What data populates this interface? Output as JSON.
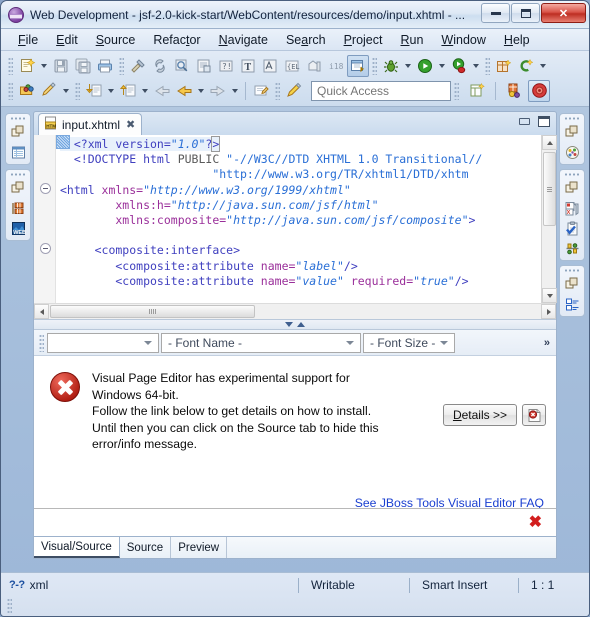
{
  "window": {
    "title": "Web Development - jsf-2.0-kick-start/WebContent/resources/demo/input.xhtml - ...",
    "logo_name": "eclipse-logo",
    "buttons": {
      "minimize": "minimize",
      "maximize": "maximize",
      "close": "close"
    }
  },
  "menubar": {
    "items": [
      {
        "label": "File",
        "mnemonic": "F"
      },
      {
        "label": "Edit",
        "mnemonic": "E"
      },
      {
        "label": "Source",
        "mnemonic": "S"
      },
      {
        "label": "Refactor",
        "mnemonic": "t"
      },
      {
        "label": "Navigate",
        "mnemonic": "N"
      },
      {
        "label": "Search",
        "mnemonic": "a"
      },
      {
        "label": "Project",
        "mnemonic": "P"
      },
      {
        "label": "Run",
        "mnemonic": "R"
      },
      {
        "label": "Window",
        "mnemonic": "W"
      },
      {
        "label": "Help",
        "mnemonic": "H"
      }
    ]
  },
  "toolbar": {
    "row1": [
      "new-wizard-icon",
      "new-wizard-dropdown",
      "save-icon",
      "save-all-icon",
      "print-icon",
      "build-all-icon",
      "link-icon",
      "search-icon",
      "print-preview-icon",
      "external-tools-icon",
      "text-tool-icon",
      "spellcheck-icon",
      "el-validator-icon",
      "open-type-icon",
      "i18n-icon",
      "open-web-browser-icon",
      "debug-icon",
      "debug-dropdown",
      "run-icon",
      "run-dropdown",
      "run-as-server-icon",
      "run-as-dropdown",
      "new-jsf-project-icon",
      "new-seam-icon",
      "new-seam-dropdown"
    ],
    "row2": [
      "open-resource-icon",
      "annotation-icon",
      "annotation-dropdown",
      "next-annotation-icon",
      "next-annotation-dropdown",
      "previous-annotation-icon",
      "previous-annotation-dropdown",
      "back-icon",
      "back-arrow-icon",
      "back-dropdown",
      "forward-arrow-icon",
      "forward-dropdown",
      "open-task-icon",
      "pencil-icon"
    ],
    "quick_access": {
      "placeholder": "Quick Access",
      "value": ""
    },
    "perspective": {
      "open_perspective": "open-perspective-icon",
      "web_development": "web-development-perspective-icon",
      "jboss_perspective": "jboss-perspective-icon"
    }
  },
  "fastview_left": {
    "groups": [
      {
        "icons": [
          "restore-icon",
          "project-explorer-icon"
        ]
      },
      {
        "icons": [
          "restore-icon",
          "palette-icon",
          "web-projects-icon"
        ]
      }
    ]
  },
  "fastview_right": {
    "groups": [
      {
        "icons": [
          "restore-icon",
          "outline-icon"
        ]
      },
      {
        "icons": [
          "restore-icon",
          "properties-icon",
          "tasks-icon",
          "jboss-tools-icon"
        ]
      },
      {
        "icons": [
          "restore-icon",
          "structure-icon"
        ]
      }
    ]
  },
  "editor": {
    "tab": {
      "label": "input.xhtml",
      "icon": "html-file-icon",
      "close": "✖"
    },
    "controls": {
      "minimize": "minimize",
      "maximize": "maximize"
    },
    "code_lines": [
      {
        "indent": 0,
        "fold": false,
        "tokens": [
          {
            "t": "<?xml version=",
            "c": "pi"
          },
          {
            "t": "\"1.0\"",
            "c": "val"
          },
          {
            "t": "?>",
            "c": "pi"
          }
        ]
      },
      {
        "indent": 0,
        "fold": false,
        "tokens": [
          {
            "t": "<!DOCTYPE html ",
            "c": "pi"
          },
          {
            "t": "PUBLIC ",
            "c": "doctype"
          },
          {
            "t": "\"-//W3C//DTD XHTML 1.0 Transitional//",
            "c": "str2"
          }
        ]
      },
      {
        "indent": 0,
        "fold": false,
        "tokens": [
          {
            "t": "                    ",
            "c": "txt"
          },
          {
            "t": "\"http://www.w3.org/TR/xhtml1/DTD/xhtm",
            "c": "str2"
          }
        ]
      },
      {
        "indent": 0,
        "fold": true,
        "tokens": [
          {
            "t": "<html ",
            "c": "pi"
          },
          {
            "t": "xmlns=",
            "c": "attr"
          },
          {
            "t": "\"http://www.w3.org/1999/xhtml\"",
            "c": "val"
          }
        ]
      },
      {
        "indent": 0,
        "fold": false,
        "tokens": [
          {
            "t": "      ",
            "c": "txt"
          },
          {
            "t": "xmlns:h=",
            "c": "attr"
          },
          {
            "t": "\"http://java.sun.com/jsf/html\"",
            "c": "val"
          }
        ]
      },
      {
        "indent": 0,
        "fold": false,
        "tokens": [
          {
            "t": "      ",
            "c": "txt"
          },
          {
            "t": "xmlns:composite=",
            "c": "attr"
          },
          {
            "t": "\"http://java.sun.com/jsf/composite\"",
            "c": "val"
          },
          {
            "t": ">",
            "c": "pi"
          }
        ]
      },
      {
        "indent": 0,
        "fold": false,
        "tokens": [
          {
            "t": "",
            "c": "txt"
          }
        ]
      },
      {
        "indent": 0,
        "fold": true,
        "tokens": [
          {
            "t": "   <composite:interface>",
            "c": "pi"
          }
        ]
      },
      {
        "indent": 0,
        "fold": false,
        "tokens": [
          {
            "t": "      <composite:attribute ",
            "c": "pi"
          },
          {
            "t": "name=",
            "c": "attr"
          },
          {
            "t": "\"label\"",
            "c": "val"
          },
          {
            "t": "/>",
            "c": "pi"
          }
        ]
      },
      {
        "indent": 0,
        "fold": false,
        "tokens": [
          {
            "t": "      <composite:attribute ",
            "c": "pi"
          },
          {
            "t": "name=",
            "c": "attr"
          },
          {
            "t": "\"value\"",
            "c": "val"
          },
          {
            "t": " required=",
            "c": "attr"
          },
          {
            "t": "\"true\"",
            "c": "val"
          },
          {
            "t": "/>",
            "c": "pi"
          }
        ]
      }
    ]
  },
  "visual_toolbar": {
    "style_combo": {
      "value": "",
      "name": "style-combo"
    },
    "font_name_combo": {
      "value": "- Font Name -"
    },
    "font_size_combo": {
      "value": "- Font Size -"
    },
    "overflow": "»"
  },
  "error_panel": {
    "icon": "error-icon",
    "message_lines": [
      "Visual Page Editor has experimental support for",
      "Windows 64-bit.",
      "Follow the link below to get details on how to install.",
      "Until then you can click on the Source tab to hide this",
      "error/info message."
    ],
    "details_button": {
      "label": "Details >>",
      "mnemonic": "D"
    },
    "copy_button_icon": "copy-error-icon",
    "link": "See JBoss Tools Visual Editor FAQ",
    "footer_close": "✖"
  },
  "bottom_tabs": [
    {
      "label": "Visual/Source",
      "active": true
    },
    {
      "label": "Source",
      "active": false
    },
    {
      "label": "Preview",
      "active": false
    }
  ],
  "statusbar": {
    "left_icon": "xml-status-icon",
    "left_label": "xml",
    "cells": [
      "Writable",
      "Smart Insert",
      "1 : 1"
    ]
  },
  "colors": {
    "accent": "#2a6fd6",
    "error": "#b01d12",
    "link": "#1a3fd0",
    "tag": "#3f3fbf",
    "attr": "#9a2f9a",
    "value": "#2a6fd6",
    "titlebar": "#dde8f5",
    "chrome": "#a8c0dc"
  }
}
